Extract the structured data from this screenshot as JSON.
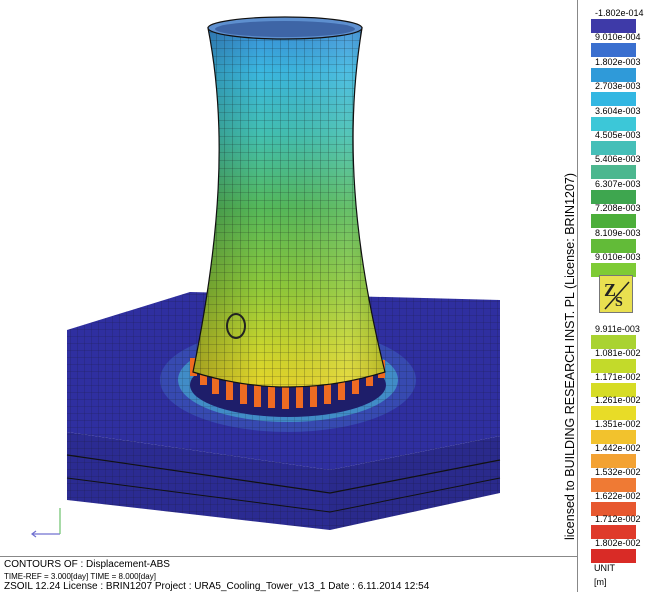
{
  "legend": {
    "top_labels": [
      "-1.802e-014",
      "9.010e-004",
      "1.802e-003",
      "2.703e-003",
      "3.604e-003",
      "4.505e-003",
      "5.406e-003",
      "6.307e-003",
      "7.208e-003",
      "8.109e-003",
      "9.010e-003"
    ],
    "bottom_labels": [
      "9.911e-003",
      "1.081e-002",
      "1.171e-002",
      "1.261e-002",
      "1.351e-002",
      "1.442e-002",
      "1.532e-002",
      "1.622e-002",
      "1.712e-002",
      "1.802e-002"
    ],
    "top_colors": [
      "#3e3aa8",
      "#3a6fcf",
      "#2f9ad9",
      "#33b7e2",
      "#3cc7d8",
      "#45bfb8",
      "#4cb78f",
      "#3ea64f",
      "#4cae3a",
      "#62bb38",
      "#7ecb35"
    ],
    "bottom_colors": [
      "#a9d331",
      "#c3da2a",
      "#d6dc25",
      "#e8dc27",
      "#f2c22d",
      "#f3a233",
      "#ef7a34",
      "#e7582f",
      "#df3a2a",
      "#d92b26"
    ],
    "unit_label": "UNIT",
    "unit_value": "[m]",
    "license_text": "licensed to BUILDING RESEARCH INST. PL  (License: BRIN1207)"
  },
  "footer": {
    "contours": "CONTOURS OF : Displacement-ABS",
    "time": "TIME-REF = 3.000[day] TIME = 8.000[day]",
    "info": "ZSOIL 12.24    License : BRIN1207    Project : URA5_Cooling_Tower_v13_1      Date : 6.11.2014  12:54"
  },
  "colors": {
    "foundation": "#2f2fa0",
    "tower_top": "#3bb2e0",
    "tower_mid": "#52b86b",
    "tower_low": "#a8d233",
    "tower_base": "#e3d82a",
    "columns": "#ee6b22"
  }
}
